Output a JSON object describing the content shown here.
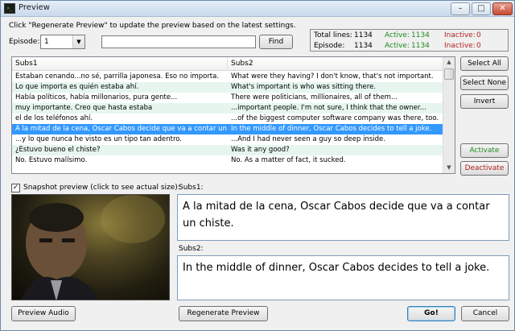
{
  "window": {
    "title": "Preview",
    "icon": "terminal-app-icon"
  },
  "instructions": "Click \"Regenerate Preview\" to update the preview based on the latest settings.",
  "episode": {
    "label": "Episode:",
    "selected": "1"
  },
  "search": {
    "value": "",
    "find_label": "Find"
  },
  "stats": {
    "total_lines_label": "Total lines:",
    "total_lines": "1134",
    "episode_label": "Episode:",
    "episode_lines": "1134",
    "active_label": "Active:",
    "active_total": "1134",
    "active_episode": "1134",
    "inactive_label": "Inactive:",
    "inactive_total": "0",
    "inactive_episode": "0"
  },
  "list": {
    "columns": [
      "Subs1",
      "Subs2"
    ],
    "rows": [
      {
        "subs1": "Estaban cenando...no sé, parrilla japonesa. Eso no importa.",
        "subs2": "What were they having? I don't know, that's not important."
      },
      {
        "subs1": "Lo que importa es quién estaba ahí.",
        "subs2": "What's important is who was sitting there."
      },
      {
        "subs1": "Había políticos, había millonarios, pura gente...",
        "subs2": "There were politicians, millionaires, all of them..."
      },
      {
        "subs1": "muy importante. Creo que hasta estaba",
        "subs2": "...important people. I'm not sure, I think that the owner..."
      },
      {
        "subs1": "el de los teléfonos ahí.",
        "subs2": "...of the biggest computer software company was there, too."
      },
      {
        "subs1": "A la mitad de la cena, Oscar Cabos decide que va a contar un chiste.",
        "subs2": "In the middle of dinner, Oscar Cabos decides to tell a joke."
      },
      {
        "subs1": "...y lo que nunca he visto es un tipo tan adentro.",
        "subs2": "...And I had never seen a guy so deep inside."
      },
      {
        "subs1": "¿Estuvo bueno el chiste?",
        "subs2": "Was it any good?"
      },
      {
        "subs1": "No. Estuvo malísimo.",
        "subs2": "No. As a matter of fact, it sucked."
      }
    ],
    "selected_index": 5
  },
  "side_buttons": {
    "select_all": "Select All",
    "select_none": "Select None",
    "invert": "Invert",
    "activate": "Activate",
    "deactivate": "Deactivate"
  },
  "snapshot": {
    "label": "Snapshot preview (click to see actual size):",
    "checked": true
  },
  "subs1_preview": {
    "label": "Subs1:",
    "text": "A la mitad de la cena, Oscar Cabos decide que va a contar un chiste."
  },
  "subs2_preview": {
    "label": "Subs2:",
    "text": "In the middle of dinner, Oscar Cabos decides to tell a joke."
  },
  "bottom_buttons": {
    "preview_audio": "Preview Audio",
    "regenerate": "Regenerate Preview",
    "go": "Go!",
    "cancel": "Cancel"
  }
}
